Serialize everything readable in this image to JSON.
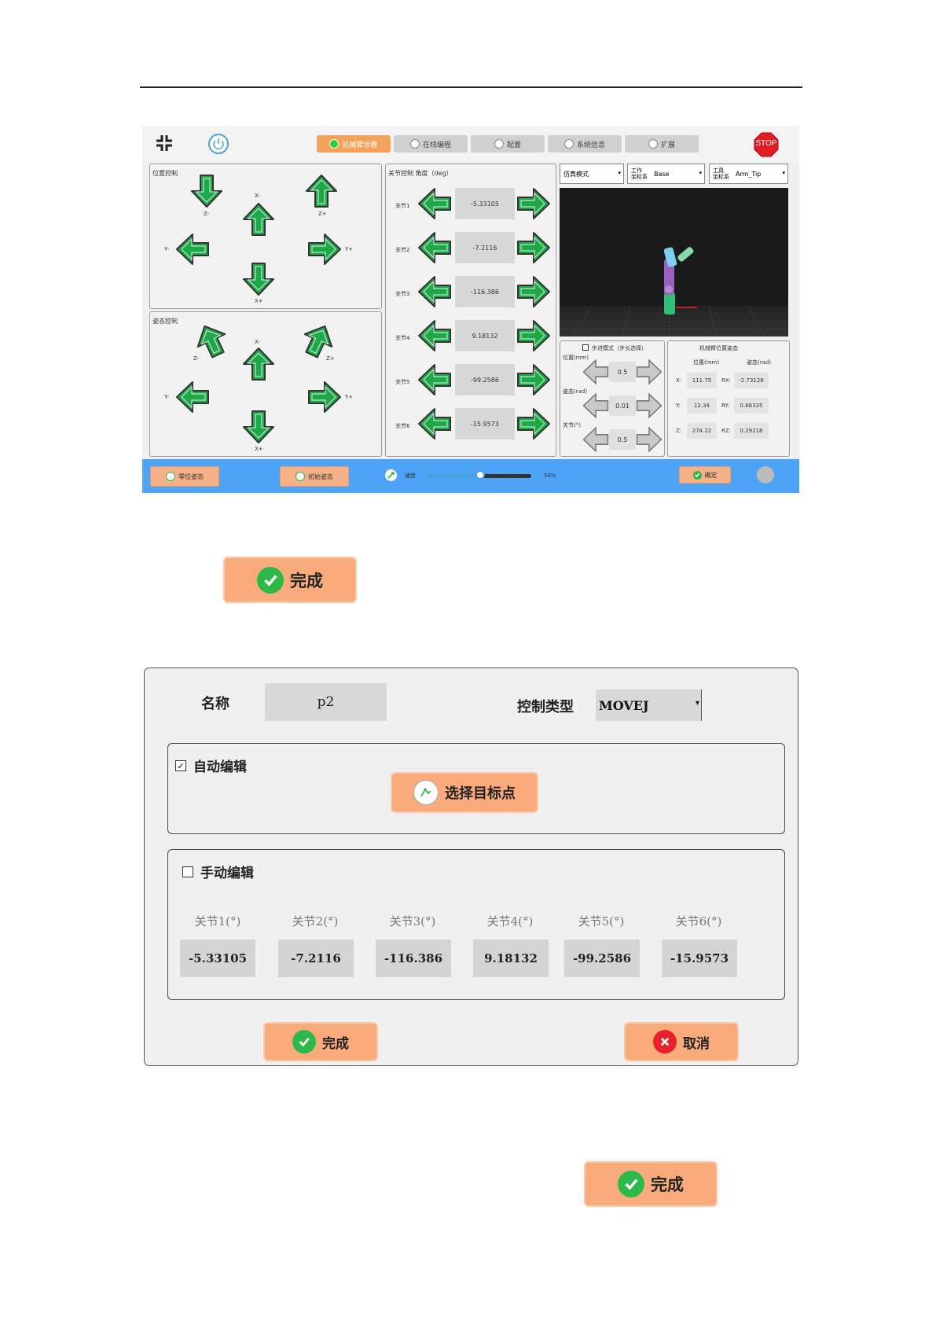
{
  "teach_panel": {
    "tabs": [
      {
        "label": "机械臂示教",
        "active": true
      },
      {
        "label": "在线编程",
        "active": false
      },
      {
        "label": "配置",
        "active": false
      },
      {
        "label": "系统信息",
        "active": false
      },
      {
        "label": "扩展",
        "active": false
      }
    ],
    "stop_label": "STOP",
    "position_control": {
      "title": "位置控制",
      "labels": {
        "z_minus": "Z-",
        "x_minus": "X-",
        "z_plus": "Z+",
        "y_minus": "Y-",
        "y_plus": "Y+",
        "x_plus": "X+"
      }
    },
    "attitude_control": {
      "title": "姿态控制",
      "labels": {
        "z_minus": "Z-",
        "x_minus": "X-",
        "z_plus": "Z+",
        "y_minus": "Y-",
        "y_plus": "Y+",
        "x_plus": "X+"
      }
    },
    "joint_control": {
      "title": "关节控制 角度（deg）",
      "joints": [
        {
          "label": "关节1",
          "value": "-5.33105"
        },
        {
          "label": "关节2",
          "value": "-7.2116"
        },
        {
          "label": "关节3",
          "value": "-116.386"
        },
        {
          "label": "关节4",
          "value": "9.18132"
        },
        {
          "label": "关节5",
          "value": "-99.2586"
        },
        {
          "label": "关节6",
          "value": "-15.9573"
        }
      ]
    },
    "mode_select": "仿真模式",
    "work_frame": {
      "label": "工作\n坐标系",
      "value": "Base"
    },
    "tool_frame": {
      "label": "工具\n坐标系",
      "value": "Arm_Tip"
    },
    "step_mode": {
      "title": "步进模式（步长选择）",
      "rows": [
        {
          "label": "位置(mm)",
          "value": "0.5"
        },
        {
          "label": "姿态(rad)",
          "value": "0.01"
        },
        {
          "label": "关节(°)",
          "value": "0.5"
        }
      ]
    },
    "arm_pose": {
      "title": "机械臂位置姿态",
      "pos_header": "位置(mm)",
      "att_header": "姿态(rad)",
      "rows": [
        {
          "axis": "X:",
          "pos": "111.75",
          "rot_axis": "RX:",
          "rot": "-2.73128"
        },
        {
          "axis": "Y:",
          "pos": "12.34",
          "rot_axis": "RY:",
          "rot": "0.66335"
        },
        {
          "axis": "Z:",
          "pos": "274.22",
          "rot_axis": "RZ:",
          "rot": "0.29218"
        }
      ]
    },
    "bottom": {
      "zero_pose": "零位姿态",
      "init_pose": "初始姿态",
      "speed_label": "速度",
      "speed_text": "50%",
      "speed_fraction": 0.5,
      "confirm": "确定"
    }
  },
  "done_button_1": "完成",
  "dialog": {
    "name_label": "名称",
    "name_value": "p2",
    "control_type_label": "控制类型",
    "control_type_value": "MOVEJ",
    "auto_edit": {
      "label": "自动编辑",
      "checked": true,
      "select_target": "选择目标点"
    },
    "manual_edit": {
      "label": "手动编辑",
      "checked": false,
      "joints": [
        {
          "label": "关节1(°)",
          "value": "-5.33105"
        },
        {
          "label": "关节2(°)",
          "value": "-7.2116"
        },
        {
          "label": "关节3(°)",
          "value": "-116.386"
        },
        {
          "label": "关节4(°)",
          "value": "9.18132"
        },
        {
          "label": "关节5(°)",
          "value": "-99.2586"
        },
        {
          "label": "关节6(°)",
          "value": "-15.9573"
        }
      ]
    },
    "done": "完成",
    "cancel": "取消"
  },
  "done_button_2": "完成"
}
